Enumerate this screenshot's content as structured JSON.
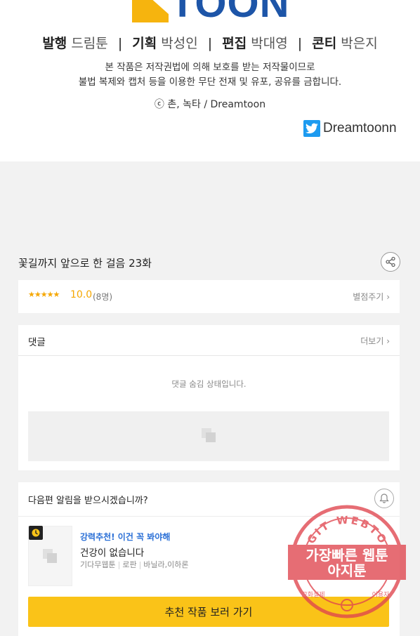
{
  "logo": {
    "text": "TOON"
  },
  "staff": {
    "publisher_role": "발행",
    "publisher_name": "드림툰",
    "planning_role": "기획",
    "planning_name": "박성인",
    "editing_role": "편집",
    "editing_name": "박대영",
    "storyboard_role": "콘티",
    "storyboard_name": "박은지",
    "separator": "|"
  },
  "notice": {
    "line1": "본 작품은 저작권법에 의해 보호를 받는 저작물이므로",
    "line2": "불법 복제와 캡처 등을 이용한 무단 전재 및 유포, 공유를 금합니다."
  },
  "copyright": "ⓒ 촌, 녹타 / Dreamtoon",
  "twitter": {
    "icon": "twitter-bird-icon",
    "label": "Dreamtoonn"
  },
  "episode": {
    "title": "꽃길까지 앞으로 한 걸음 23화",
    "share_icon": "share-icon"
  },
  "rating": {
    "stars": "★★★★★",
    "score": "10.0",
    "count": "(8명)",
    "rate_label": "별점주기",
    "rate_chevron": "›"
  },
  "comments": {
    "title": "댓글",
    "more_label": "더보기",
    "more_chevron": "›",
    "hidden_message": "댓글 숨김 상태입니다."
  },
  "notify": {
    "question": "다음편 알림을 받으시겠습니까?",
    "bell_icon": "bell-icon",
    "recommend_tag": "강력추천! 이건 꼭 봐야해",
    "recommend_title": "건강이 없습니다",
    "meta_source": "기다무웹툰",
    "meta_genre": "로판",
    "meta_authors": "바닐라,이하론",
    "button_label": "추천 작품 보러 가기"
  },
  "watermark": {
    "ring_text": "AGIT WEBTOON",
    "line1": "가장빠른 웹툰",
    "line2": "아지툰",
    "left_small": "고화질제",
    "right_small": "이용자"
  },
  "colors": {
    "accent_yellow": "#fac318",
    "star_orange": "#f5a700",
    "link_blue": "#2a6fd6",
    "logo_blue": "#1d55a8",
    "logo_yellow": "#f6b40e",
    "twitter_blue": "#1d9bf0",
    "stamp_red": "#e0454e"
  }
}
